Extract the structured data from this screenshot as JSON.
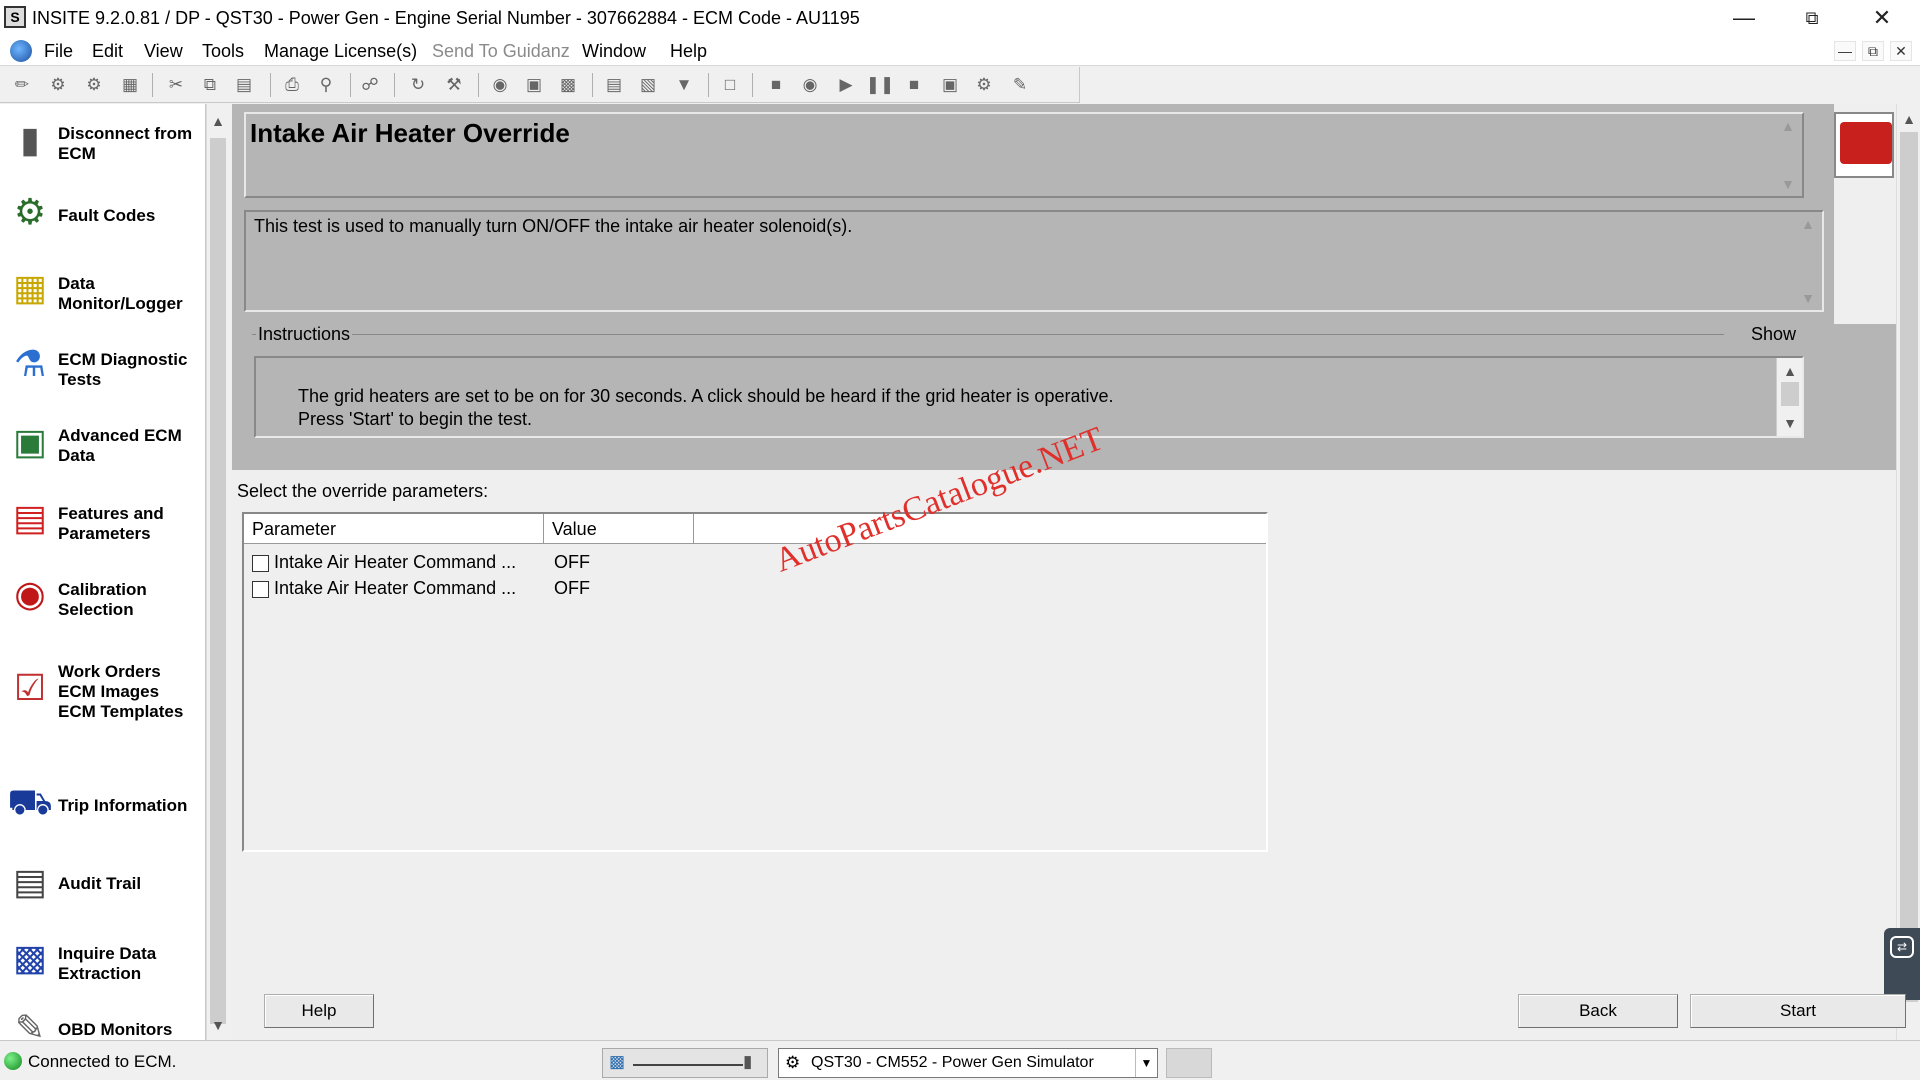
{
  "window": {
    "title": "INSITE 9.2.0.81  / DP - QST30 - Power Gen  - Engine Serial Number - 307662884 - ECM Code - AU1195",
    "app_icon": "S"
  },
  "menu": [
    {
      "label": "File",
      "disabled": false
    },
    {
      "label": "Edit",
      "disabled": false
    },
    {
      "label": "View",
      "disabled": false
    },
    {
      "label": "Tools",
      "disabled": false
    },
    {
      "label": "Manage License(s)",
      "disabled": false
    },
    {
      "label": "Send To Guidanz",
      "disabled": true
    },
    {
      "label": "Window",
      "disabled": false
    },
    {
      "label": "Help",
      "disabled": false
    }
  ],
  "sidebar": {
    "items": [
      {
        "label": "Disconnect from\nECM",
        "icon": "disconnect-icon"
      },
      {
        "label": "Fault Codes",
        "icon": "fault-codes-icon"
      },
      {
        "label": "Data\nMonitor/Logger",
        "icon": "data-monitor-icon"
      },
      {
        "label": "ECM Diagnostic\nTests",
        "icon": "diagnostic-tests-icon"
      },
      {
        "label": "Advanced ECM\nData",
        "icon": "advanced-ecm-data-icon"
      },
      {
        "label": "Features and\nParameters",
        "icon": "features-parameters-icon"
      },
      {
        "label": "Calibration\nSelection",
        "icon": "calibration-icon"
      },
      {
        "label": "Work Orders\nECM Images\nECM Templates",
        "icon": "work-orders-icon"
      },
      {
        "label": "Trip Information",
        "icon": "trip-information-icon"
      },
      {
        "label": "Audit Trail",
        "icon": "audit-trail-icon"
      },
      {
        "label": "Inquire Data\nExtraction",
        "icon": "inquire-data-icon"
      },
      {
        "label": "OBD Monitors",
        "icon": "obd-monitors-icon"
      }
    ]
  },
  "test": {
    "title": "Intake Air Heater Override",
    "description": "This test is used to manually turn ON/OFF the intake air heater solenoid(s).",
    "instructions_label": "Instructions",
    "show_label": "Show",
    "instructions": [
      "The grid heaters are set to be on for 30 seconds.  A click should be heard if the grid heater is operative.",
      "Press 'Start' to begin the test."
    ]
  },
  "override": {
    "prompt": "Select the override parameters:",
    "columns": [
      "Parameter",
      "Value"
    ],
    "rows": [
      {
        "parameter": "Intake Air Heater Command ...",
        "value": "OFF",
        "checked": false
      },
      {
        "parameter": "Intake Air Heater Command ...",
        "value": "OFF",
        "checked": false
      }
    ]
  },
  "watermark": "AutoPartsCatalogue.NET",
  "buttons": {
    "help": "Help",
    "back": "Back",
    "start": "Start"
  },
  "status": {
    "connection": "Connected to ECM.",
    "device": "QST30 - CM552 - Power Gen Simulator"
  },
  "colors": {
    "panel": "#b5b5b5",
    "watermark": "#e0302c",
    "status_led": "#1fa02e"
  }
}
